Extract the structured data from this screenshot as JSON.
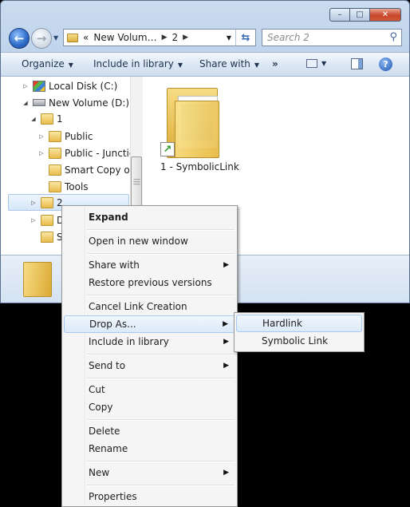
{
  "window": {
    "address": {
      "part1": "New Volum…",
      "part2": "2",
      "overflow": "«"
    },
    "search_placeholder": "Search 2",
    "caption": {
      "minimize": "–",
      "maximize": "□",
      "close": "✕"
    }
  },
  "command_bar": {
    "organize": "Organize",
    "include_in_library": "Include in library",
    "share_with": "Share with",
    "more": "»",
    "help": "?"
  },
  "nav_tree": {
    "local_disk": "Local Disk (C:)",
    "new_volume": "New Volume (D:)",
    "folder_1": "1",
    "public": "Public",
    "public_junction": "Public - Junctio",
    "smart_copy": "Smart Copy of ",
    "tools": "Tools",
    "folder_2": "2",
    "folder_d": "D",
    "folder_s": "Sy"
  },
  "content": {
    "item_label": "1 - SymbolicLink"
  },
  "context_menu": {
    "expand": "Expand",
    "open_new_window": "Open in new window",
    "share_with": "Share with",
    "restore_versions": "Restore previous versions",
    "cancel_link": "Cancel Link Creation",
    "drop_as": "Drop As...",
    "include_library": "Include in library",
    "send_to": "Send to",
    "cut": "Cut",
    "copy": "Copy",
    "delete": "Delete",
    "rename": "Rename",
    "new": "New",
    "properties": "Properties"
  },
  "submenu": {
    "hardlink": "Hardlink",
    "symbolic_link": "Symbolic Link"
  }
}
